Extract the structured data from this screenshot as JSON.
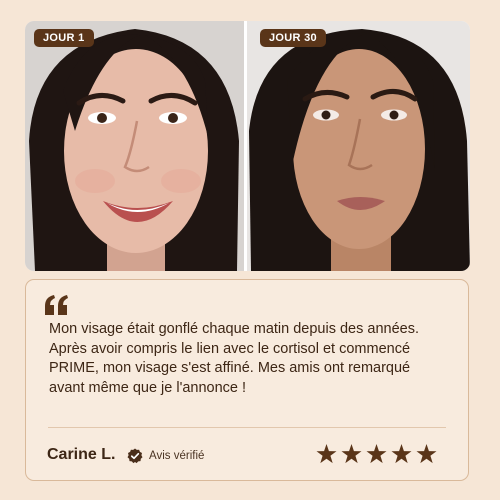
{
  "before_after": {
    "before": {
      "label": "JOUR 1",
      "image": "woman-face-photo-smiling-puffy"
    },
    "after": {
      "label": "JOUR 30",
      "image": "woman-face-photo-slimmer"
    }
  },
  "review": {
    "quote_icon": "quote-icon",
    "text": "Mon visage était gonflé chaque matin depuis des années. Après avoir compris le lien avec le cortisol et commencé PRIME, mon visage s'est affiné. Mes amis ont remarqué avant même que je l'annonce !",
    "author": "Carine L.",
    "verified_icon": "check-badge-icon",
    "verified_label": "Avis vérifié",
    "rating": 5,
    "rating_max": 5
  },
  "colors": {
    "page_background": "#f6e6d6",
    "accent_brown": "#5a3519",
    "text_dark": "#3d2615",
    "card_border": "#d9b99a"
  }
}
